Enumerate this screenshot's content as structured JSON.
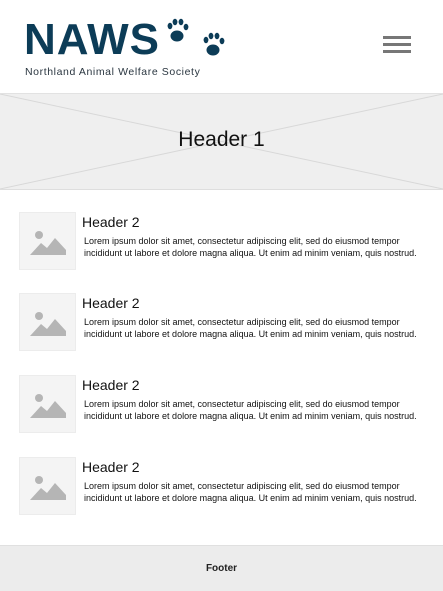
{
  "brand": {
    "name": "NAWS",
    "tagline": "Northland Animal Welfare Society",
    "logo_color": "#0c3c57",
    "logo_icon": "paw-prints-icon"
  },
  "nav": {
    "menu_icon": "hamburger-menu-icon"
  },
  "hero": {
    "title": "Header 1"
  },
  "items": [
    {
      "title": "Header 2",
      "body": "Lorem ipsum dolor sit amet, consectetur adipiscing elit, sed do eiusmod tempor incididunt ut labore et dolore magna aliqua. Ut enim ad minim veniam, quis nostrud.",
      "icon": "image-placeholder-icon"
    },
    {
      "title": "Header 2",
      "body": "Lorem ipsum dolor sit amet, consectetur adipiscing elit, sed do eiusmod tempor incididunt ut labore et dolore magna aliqua. Ut enim ad minim veniam, quis nostrud.",
      "icon": "image-placeholder-icon"
    },
    {
      "title": "Header 2",
      "body": "Lorem ipsum dolor sit amet, consectetur adipiscing elit, sed do eiusmod tempor incididunt ut labore et dolore magna aliqua. Ut enim ad minim veniam, quis nostrud.",
      "icon": "image-placeholder-icon"
    },
    {
      "title": "Header 2",
      "body": "Lorem ipsum dolor sit amet, consectetur adipiscing elit, sed do eiusmod tempor incididunt ut labore et dolore magna aliqua. Ut enim ad minim veniam, quis nostrud.",
      "icon": "image-placeholder-icon"
    }
  ],
  "footer": {
    "label": "Footer"
  }
}
